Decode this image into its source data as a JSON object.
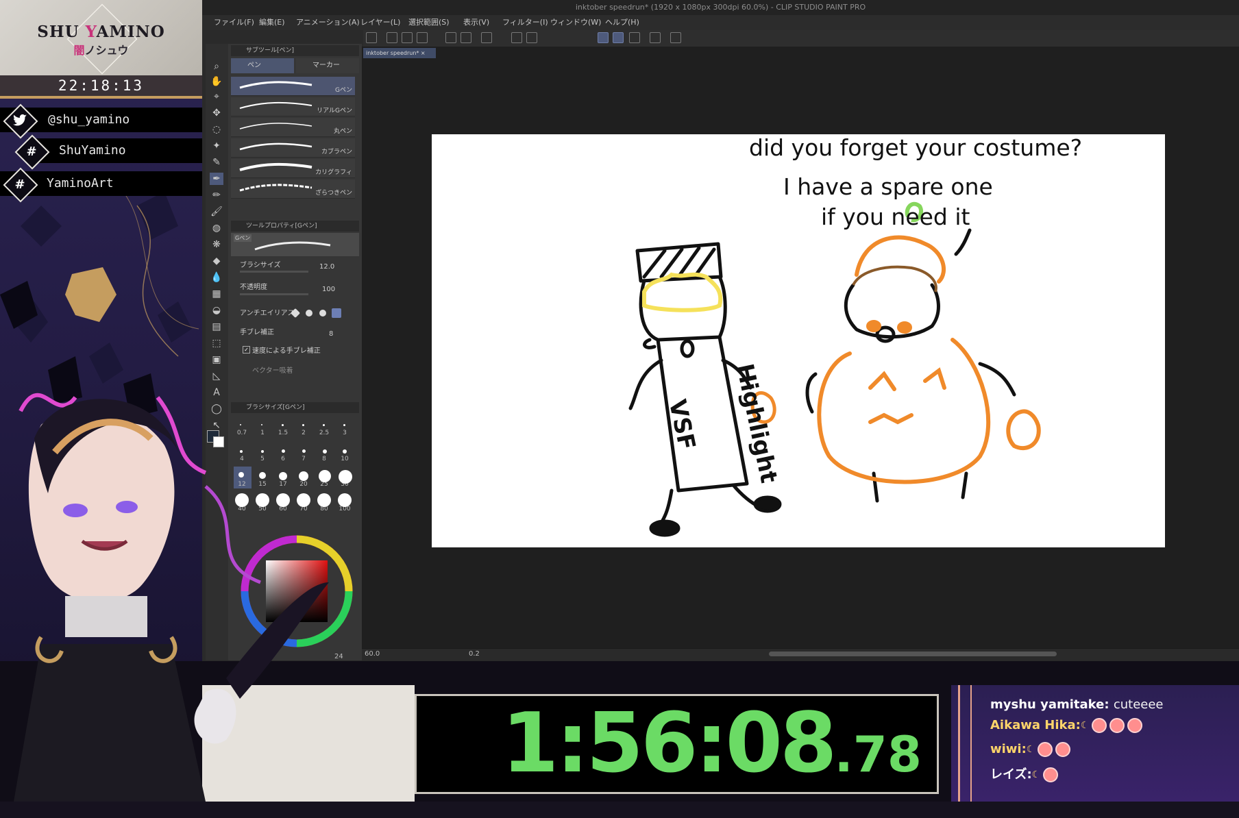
{
  "overlay": {
    "logo_name_first": "SHU ",
    "logo_name_y": "Y",
    "logo_name_rest": "AMINO",
    "logo_jp_kanji": "闇",
    "logo_jp_kana": "ノシュウ",
    "clock": "22:18:13",
    "socials": [
      {
        "icon": "twitter-bird-icon",
        "text": "@shu_yamino"
      },
      {
        "icon": "hashtag-icon",
        "glyph": "#",
        "text": "ShuYamino"
      },
      {
        "icon": "hashtag-icon",
        "glyph": "#",
        "text": "YaminoArt"
      }
    ]
  },
  "app": {
    "title": "inktober speedrun* (1920 x 1080px 300dpi 60.0%) - CLIP STUDIO PAINT PRO",
    "menu": [
      "ファイル(F)",
      "編集(E)",
      "アニメーション(A)",
      "レイヤー(L)",
      "選択範囲(S)",
      "表示(V)",
      "フィルター(I)",
      "ウィンドウ(W)",
      "ヘルプ(H)"
    ],
    "doc_tab": "inktober speedrun* ×",
    "subtool_header": "サブツール[ペン]",
    "subtool_tabs": [
      "ペン",
      "マーカー"
    ],
    "brushes": [
      "Gペン",
      "リアルGペン",
      "丸ペン",
      "カブラペン",
      "カリグラフィ",
      "ざらつきペン"
    ],
    "tool_property_header": "ツールプロパティ[Gペン]",
    "tool_property_brush": "Gペン",
    "properties": [
      {
        "label": "ブラシサイズ",
        "value": "12.0"
      },
      {
        "label": "不透明度",
        "value": "100"
      },
      {
        "label": "アンチエイリアス",
        "value": ""
      },
      {
        "label": "手ブレ補正",
        "value": "8"
      }
    ],
    "speed_stabilizer_label": "速度による手ブレ補正",
    "vector_snap_label": "ベクター吸着",
    "brush_size_header": "ブラシサイズ[Gペン]",
    "brush_sizes": [
      "0.7",
      "1",
      "1.5",
      "2",
      "2.5",
      "3",
      "4",
      "5",
      "6",
      "7",
      "8",
      "10",
      "12",
      "15",
      "17",
      "20",
      "25",
      "30",
      "40",
      "50",
      "60",
      "70",
      "80",
      "100"
    ],
    "selected_brush_size": "12",
    "zoom": "60.0",
    "rotation_readout": "0.2",
    "canvas_readout": "24"
  },
  "drawing": {
    "speech_lines": [
      "did you forget your costume?",
      "I have a spare one",
      "if you need it"
    ],
    "vsf_lines": [
      "Highlight",
      "VSF"
    ]
  },
  "timer": {
    "main": "1:56:08",
    "fraction": ".78",
    "color": "#6bdb65"
  },
  "chat": [
    {
      "user": "myshu yamitake:",
      "message": "cuteeee",
      "emotes": 0,
      "moon": false
    },
    {
      "user": "Aikawa Hika:",
      "message": "",
      "emotes": 3,
      "moon": true
    },
    {
      "user": "wiwi:",
      "message": "",
      "emotes": 2,
      "moon": true
    },
    {
      "user": "レイズ:",
      "message": "",
      "emotes": 1,
      "moon": true
    }
  ],
  "colors": {
    "accent_gold": "#c59d5f",
    "brand_pink": "#c8327a",
    "orange_ink": "#f08a2a",
    "yellow_hair": "#f5e15a",
    "green_stem": "#86d65c"
  }
}
